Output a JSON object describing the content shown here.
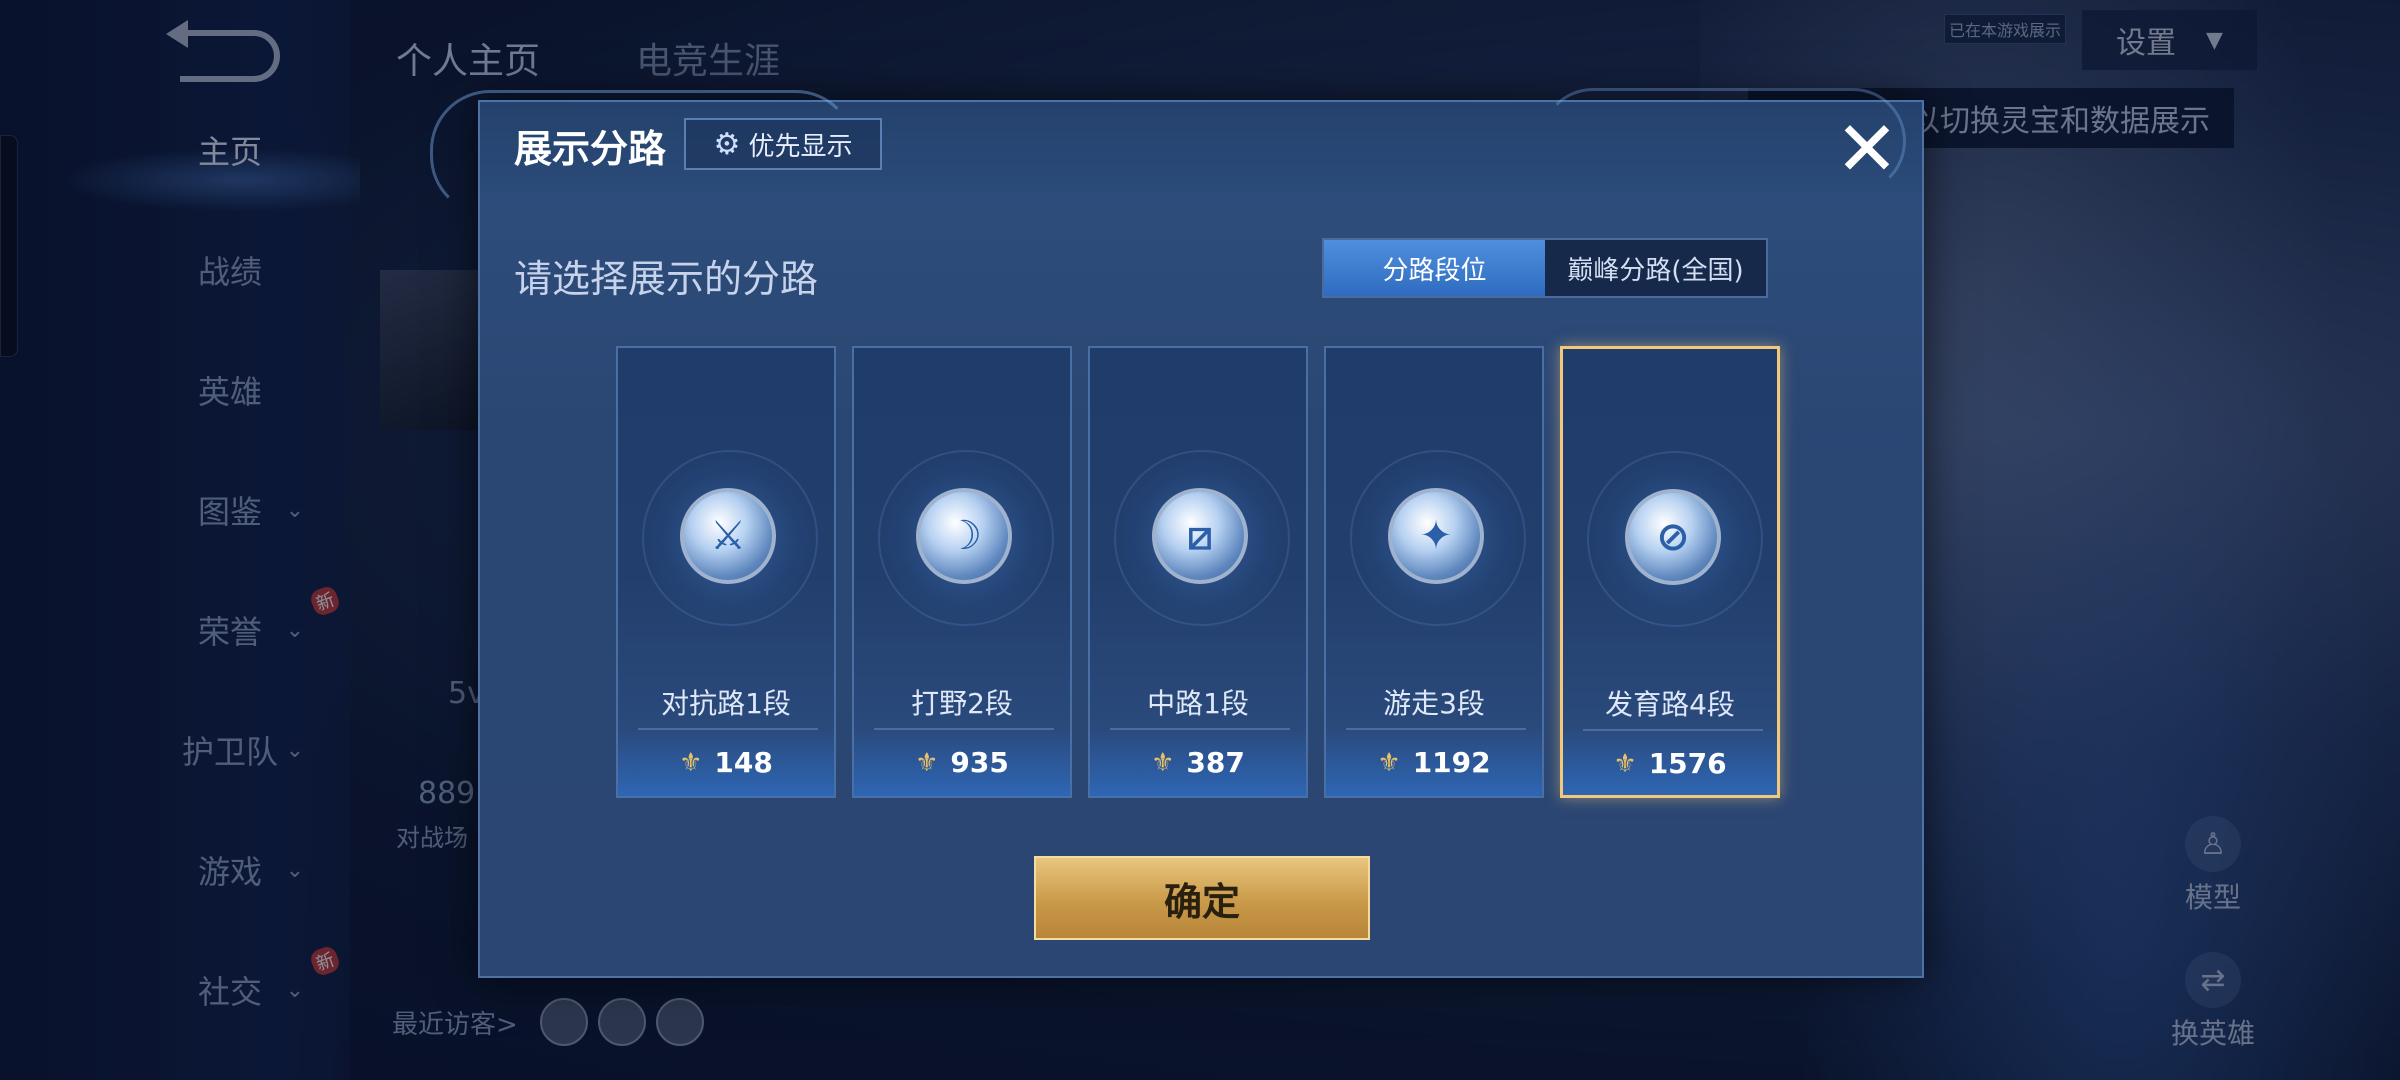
{
  "background": {
    "top_tabs": [
      "个人主页",
      "电竞生涯"
    ],
    "settings_label": "设置",
    "small_tag": "已在本游戏展示",
    "hint": "以切换灵宝和数据展示",
    "nav": [
      {
        "label": "主页",
        "active": true,
        "chevron": false,
        "new": false
      },
      {
        "label": "战绩",
        "active": false,
        "chevron": false,
        "new": false
      },
      {
        "label": "英雄",
        "active": false,
        "chevron": false,
        "new": false
      },
      {
        "label": "图鉴",
        "active": false,
        "chevron": true,
        "new": false
      },
      {
        "label": "荣誉",
        "active": false,
        "chevron": true,
        "new": true
      },
      {
        "label": "护卫队",
        "active": false,
        "chevron": true,
        "new": false
      },
      {
        "label": "游戏",
        "active": false,
        "chevron": true,
        "new": false
      },
      {
        "label": "社交",
        "active": false,
        "chevron": true,
        "new": true
      }
    ],
    "new_badge": "新",
    "fragments": {
      "a": "5v",
      "b": "889",
      "c": "对战场"
    },
    "recent_visitors": "最近访客>",
    "right_buttons": {
      "model": "模型",
      "switch_hero": "换英雄"
    }
  },
  "modal": {
    "title": "展示分路",
    "priority_button": "优先显示",
    "subtitle": "请选择展示的分路",
    "segments": [
      {
        "label": "分路段位",
        "active": true
      },
      {
        "label": "巅峰分路(全国)",
        "active": false
      }
    ],
    "cards": [
      {
        "rank": "对抗路1段",
        "score": "148",
        "icon": "sword-emblem-icon",
        "glyph": "⚔",
        "selected": false
      },
      {
        "rank": "打野2段",
        "score": "935",
        "icon": "jungle-emblem-icon",
        "glyph": "☽",
        "selected": false
      },
      {
        "rank": "中路1段",
        "score": "387",
        "icon": "mid-emblem-icon",
        "glyph": "⧄",
        "selected": false
      },
      {
        "rank": "游走3段",
        "score": "1192",
        "icon": "wings-emblem-icon",
        "glyph": "✦",
        "selected": false
      },
      {
        "rank": "发育路4段",
        "score": "1576",
        "icon": "farm-emblem-icon",
        "glyph": "⊘",
        "selected": true
      }
    ],
    "confirm": "确定"
  },
  "colors": {
    "accent_blue": "#2f6cc0",
    "selected_border": "#f2c87c",
    "confirm_gold": "#c99a48"
  }
}
